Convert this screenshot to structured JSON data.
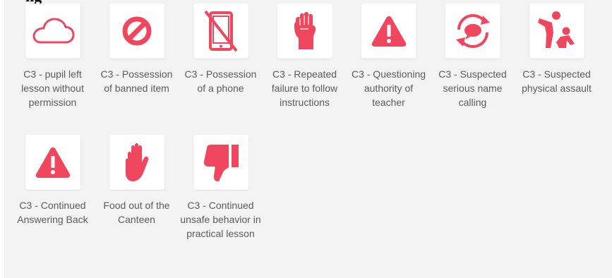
{
  "header_partial_text": "ng",
  "colors": {
    "icon": "#f0475f",
    "panel": "#f3f3f4",
    "text": "#5b5b5b"
  },
  "behaviours": [
    {
      "label": "C3 - pupil left lesson without permission",
      "icon": "cloud-icon"
    },
    {
      "label": "C3 - Possession of banned item",
      "icon": "prohibited-icon"
    },
    {
      "label": "C3 - Possession of a phone",
      "icon": "no-phone-icon"
    },
    {
      "label": "C3 - Repeated failure to follow instructions",
      "icon": "fist-icon"
    },
    {
      "label": "C3 - Questioning authority of teacher",
      "icon": "warning-icon"
    },
    {
      "label": "C3 - Suspected serious name calling",
      "icon": "speech-cycle-icon"
    },
    {
      "label": "C3 - Suspected physical assault",
      "icon": "physical-assault-icon"
    },
    {
      "label": "C3 - Continued Answering Back",
      "icon": "warning-icon"
    },
    {
      "label": "Food out of the Canteen",
      "icon": "raised-hand-icon"
    },
    {
      "label": "C3 - Continued unsafe behavior in practical lesson",
      "icon": "thumbs-down-icon"
    }
  ]
}
